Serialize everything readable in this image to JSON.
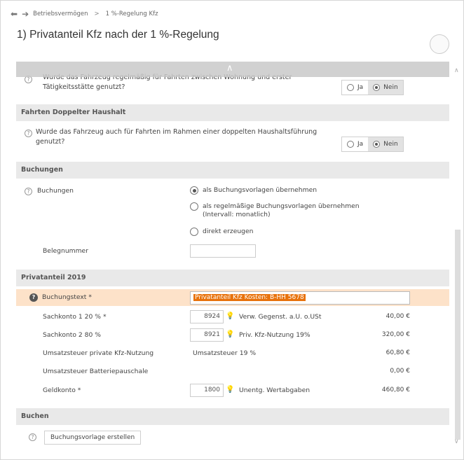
{
  "nav": {
    "back": "⬅",
    "forward": "➔",
    "crumb1": "Betriebsvermögen",
    "sep": ">",
    "crumb2": "1 %-Regelung Kfz"
  },
  "title": "1) Privatanteil Kfz nach der 1 %-Regelung",
  "arbeit": {
    "question_line1": "Wurde das Fahrzeug regelmäßig für Fahrten zwischen Wohnung und erster",
    "question_line2": "Tätigkeitsstätte genutzt?",
    "ja": "Ja",
    "nein": "Nein",
    "selected": "Nein"
  },
  "haushalt": {
    "header": "Fahrten Doppelter Haushalt",
    "question_line1": "Wurde das Fahrzeug auch für Fahrten im Rahmen einer doppelten Haushaltsführung",
    "question_line2": "genutzt?",
    "ja": "Ja",
    "nein": "Nein",
    "selected": "Nein"
  },
  "buchungen": {
    "header": "Buchungen",
    "label": "Buchungen",
    "options": [
      {
        "label": "als Buchungsvorlagen übernehmen",
        "sub": "",
        "selected": true
      },
      {
        "label": "als regelmäßige Buchungsvorlagen übernehmen",
        "sub": "(Intervall: monatlich)",
        "selected": false
      },
      {
        "label": "direkt erzeugen",
        "sub": "",
        "selected": false
      }
    ],
    "belegnummer_label": "Belegnummer",
    "belegnummer_value": ""
  },
  "privatanteil": {
    "header": "Privatanteil 2019",
    "buchungstext_label": "Buchungstext *",
    "buchungstext_value": "Privatanteil Kfz Kosten: B-HH 5678",
    "rows": [
      {
        "label": "Sachkonto 1 20 % *",
        "konto": "8924",
        "desc": "Verw. Gegenst. a.U. o.USt",
        "amount": "40,00 €"
      },
      {
        "label": "Sachkonto 2 80 %",
        "konto": "8921",
        "desc": "Priv. Kfz-Nutzung 19%",
        "amount": "320,00 €"
      },
      {
        "label": "Umsatzsteuer private Kfz-Nutzung",
        "konto": "",
        "desc": "Umsatzsteuer 19 %",
        "amount": "60,80 €"
      },
      {
        "label": "Umsatzsteuer Batteriepauschale",
        "konto": "",
        "desc": "",
        "amount": "0,00 €"
      },
      {
        "label": "Geldkonto *",
        "konto": "1800",
        "desc": "Unentg. Wertabgaben",
        "amount": "460,80 €"
      }
    ]
  },
  "buchen": {
    "header": "Buchen",
    "button": "Buchungsvorlage erstellen"
  },
  "colors": {
    "section_bg": "#e9e9e9",
    "highlight_row": "#fde2c9",
    "selection": "#e8720c"
  }
}
